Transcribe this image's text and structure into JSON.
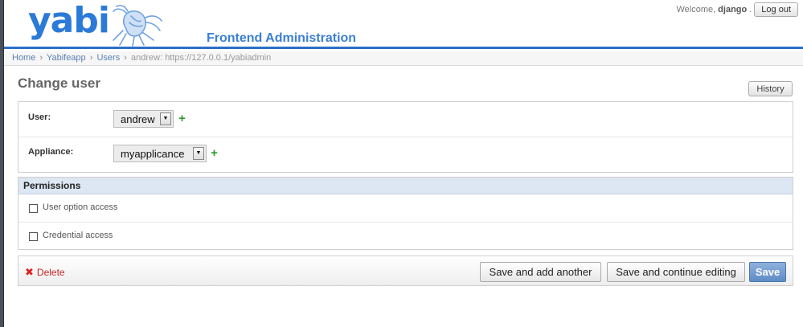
{
  "header": {
    "logo_text": "yabi",
    "site_title": "Frontend Administration",
    "welcome_prefix": "Welcome,",
    "username": "django",
    "welcome_suffix": ".",
    "logout_label": "Log out"
  },
  "breadcrumbs": {
    "items": [
      "Home",
      "Yabifeapp",
      "Users"
    ],
    "current": "andrew: https://127.0.0.1/yabiadmin",
    "separator": "›"
  },
  "page": {
    "title": "Change user",
    "history_label": "History"
  },
  "form": {
    "user_label": "User:",
    "user_value": "andrew",
    "appliance_label": "Appliance:",
    "appliance_value": "myapplicance"
  },
  "permissions": {
    "heading": "Permissions",
    "options": [
      {
        "label": "User option access",
        "checked": false
      },
      {
        "label": "Credential access",
        "checked": false
      }
    ]
  },
  "submit": {
    "delete_label": "Delete",
    "save_add_another": "Save and add another",
    "save_continue": "Save and continue editing",
    "save": "Save"
  },
  "colors": {
    "accent": "#2b6fc7",
    "link": "#5b80b2",
    "delete": "#c62828",
    "add_icon": "#2f9a2f"
  }
}
